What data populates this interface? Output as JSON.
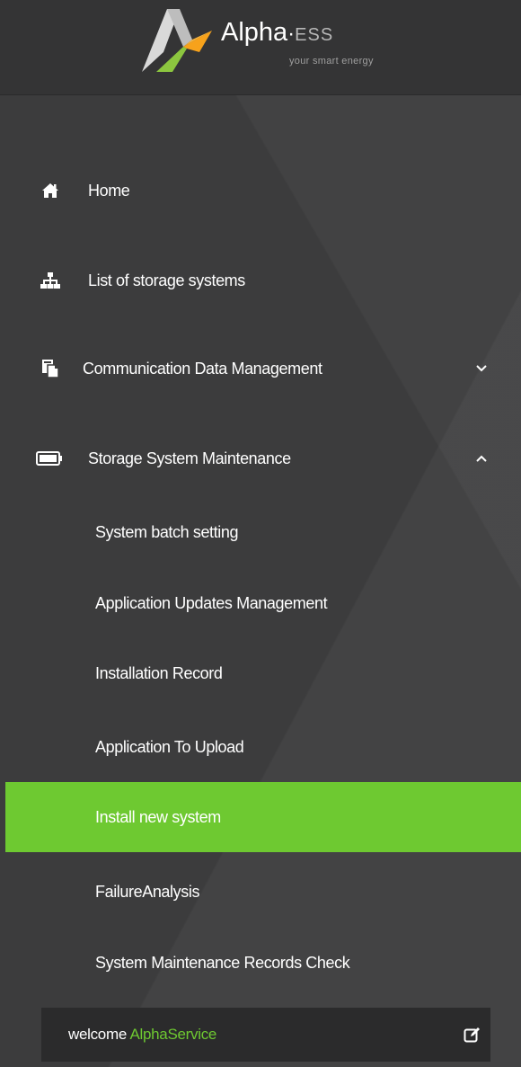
{
  "logo": {
    "brand": "Alpha",
    "dot": "·",
    "suffix": "ESS",
    "tagline": "your smart energy"
  },
  "menu": {
    "items": [
      {
        "label": "Home",
        "icon": "home-icon"
      },
      {
        "label": "List of storage systems",
        "icon": "sitemap-icon"
      },
      {
        "label": "Communication Data Management",
        "icon": "copy-icon",
        "expanded": false
      },
      {
        "label": "Storage System Maintenance",
        "icon": "battery-icon",
        "expanded": true
      }
    ],
    "sub_items": [
      {
        "label": "System batch setting"
      },
      {
        "label": "Application Updates Management"
      },
      {
        "label": "Installation Record"
      },
      {
        "label": "Application To Upload"
      },
      {
        "label": "Install new system",
        "active": true
      },
      {
        "label": "FailureAnalysis"
      },
      {
        "label": "System Maintenance Records Check"
      }
    ]
  },
  "footer": {
    "welcome": "welcome",
    "username": "AlphaService"
  },
  "colors": {
    "sidebar_bg": "#3c3c3d",
    "accent": "#6ec931"
  }
}
